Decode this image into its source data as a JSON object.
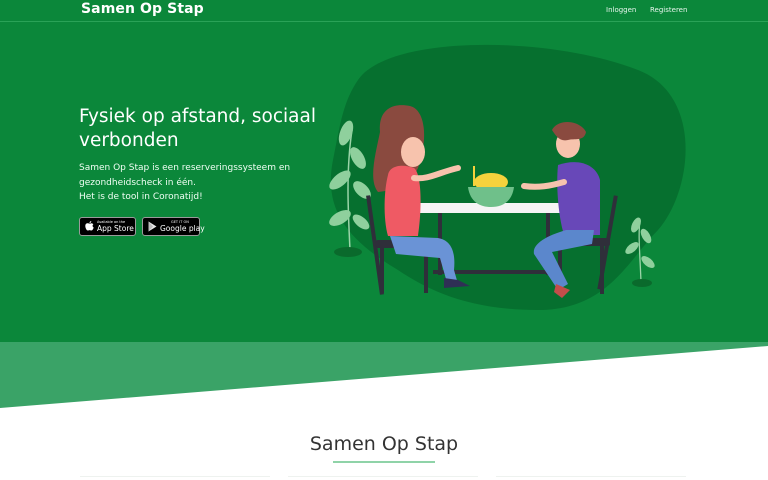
{
  "nav": {
    "brand": "Samen Op Stap",
    "login": "Inloggen",
    "register": "Registeren"
  },
  "hero": {
    "title": "Fysiek op afstand, sociaal verbonden",
    "lines": [
      "Samen Op Stap is een reserveringssysteem en",
      "gezondheidscheck in één.",
      "Het is de tool in Coronatijd!"
    ]
  },
  "badges": {
    "appstore_small": "Available on the",
    "appstore_big": "App Store",
    "googleplay_small": "GET IT ON",
    "googleplay_big": "Google play"
  },
  "section": {
    "title": "Samen Op Stap"
  },
  "colors": {
    "primary": "#0b873a",
    "band": "#3aa367",
    "blob": "#06702f"
  },
  "icons": {
    "apple": "apple-icon",
    "play": "play-store-icon"
  }
}
